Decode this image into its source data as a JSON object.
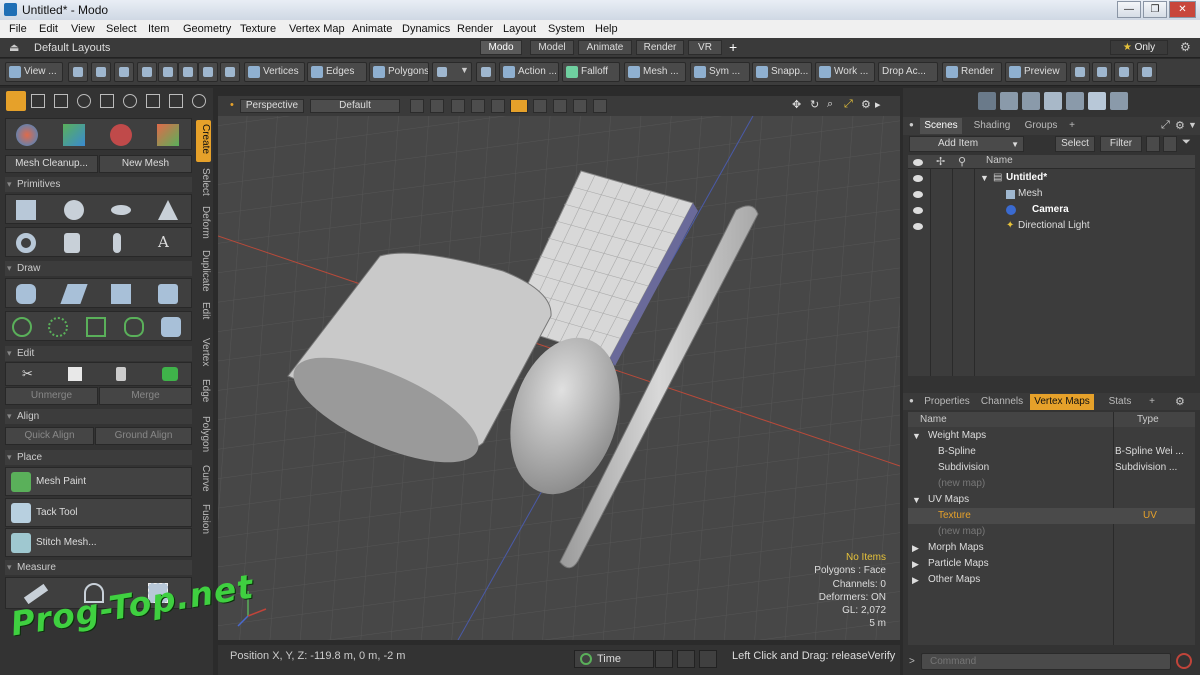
{
  "window": {
    "title": "Untitled* - Modo",
    "min": "—",
    "max": "❐",
    "close": "✕"
  },
  "menu": [
    "File",
    "Edit",
    "View",
    "Select",
    "Item",
    "Geometry",
    "Texture",
    "Vertex Map",
    "Animate",
    "Dynamics",
    "Render",
    "Layout",
    "System",
    "Help"
  ],
  "layout": {
    "default": "Default Layouts",
    "tabs": [
      "Modo",
      "Model",
      "Animate",
      "Render",
      "VR"
    ],
    "add": "+",
    "only": "Only"
  },
  "toolbar": {
    "view": "View ...",
    "vertices": "Vertices",
    "edges": "Edges",
    "polygons": "Polygons",
    "action": "Action ...",
    "falloff": "Falloff",
    "mesh": "Mesh ...",
    "sym": "Sym ...",
    "snap": "Snapp...",
    "work": "Work ...",
    "drop": "Drop Ac...",
    "render": "Render",
    "preview": "Preview"
  },
  "left": {
    "mesh_cleanup": "Mesh Cleanup...",
    "new_mesh": "New Mesh",
    "primitives": "Primitives",
    "draw": "Draw",
    "edit": "Edit",
    "unmerge": "Unmerge",
    "merge": "Merge",
    "align": "Align",
    "quick_align": "Quick Align",
    "ground_align": "Ground Align",
    "place": "Place",
    "mesh_paint": "Mesh Paint",
    "tack_tool": "Tack Tool",
    "stitch_mesh": "Stitch Mesh...",
    "measure": "Measure",
    "vtabs": [
      "Create",
      "Select",
      "Deform",
      "Duplicate",
      "Edit",
      "Vertex",
      "Edge",
      "Polygon",
      "Curve",
      "Fusion"
    ]
  },
  "viewport": {
    "perspective": "Perspective",
    "default": "Default",
    "hud": [
      "No Items",
      "Polygons : Face",
      "Channels: 0",
      "Deformers: ON",
      "GL: 2,072",
      "5 m"
    ]
  },
  "status": {
    "position": "Position X, Y, Z:   -119.8 m, 0 m, -2 m",
    "time": "Time",
    "hint": "Left Click and Drag:  releaseVerify"
  },
  "scenes": {
    "tabs": [
      "Scenes",
      "Shading",
      "Groups",
      "+"
    ],
    "add_item": "Add Item",
    "select": "Select",
    "filter": "Filter",
    "name_col": "Name",
    "items": [
      "Untitled*",
      "Mesh",
      "Camera",
      "Directional Light"
    ]
  },
  "props": {
    "tabs": [
      "Properties",
      "Channels",
      "Vertex Maps",
      "Stats",
      "+"
    ],
    "col_name": "Name",
    "col_type": "Type",
    "rows": [
      {
        "name": "Weight Maps",
        "type": ""
      },
      {
        "name": "B-Spline",
        "type": "B-Spline Wei ..."
      },
      {
        "name": "Subdivision",
        "type": "Subdivision ..."
      },
      {
        "name": "(new map)",
        "type": ""
      },
      {
        "name": "UV Maps",
        "type": ""
      },
      {
        "name": "Texture",
        "type": "UV"
      },
      {
        "name": "(new map)",
        "type": ""
      },
      {
        "name": "Morph Maps",
        "type": ""
      },
      {
        "name": "Particle Maps",
        "type": ""
      },
      {
        "name": "Other Maps",
        "type": ""
      }
    ]
  },
  "command_placeholder": "Command",
  "watermark": "Prog-Top.net",
  "colors": {
    "accent": "#e6a12a",
    "selected_row": "#4a4a4a",
    "viewport_bg": "#474747"
  }
}
